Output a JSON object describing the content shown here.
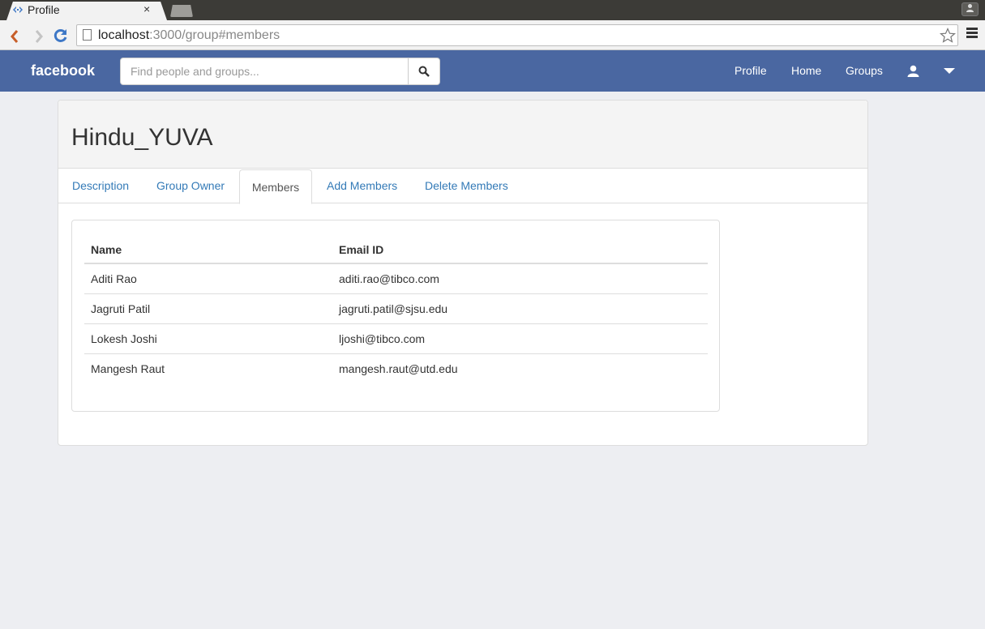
{
  "browser": {
    "tab_title": "Profile",
    "tab_close": "×",
    "url_host": "localhost",
    "url_path": ":3000/group#members"
  },
  "header": {
    "brand": "facebook",
    "search_placeholder": "Find people and groups...",
    "nav": [
      "Profile",
      "Home",
      "Groups"
    ]
  },
  "group": {
    "title": "Hindu_YUVA",
    "tabs": [
      "Description",
      "Group Owner",
      "Members",
      "Add Members",
      "Delete Members"
    ],
    "active_tab": "Members"
  },
  "members_table": {
    "columns": [
      "Name",
      "Email ID"
    ],
    "rows": [
      {
        "name": "Aditi Rao",
        "email": "aditi.rao@tibco.com"
      },
      {
        "name": "Jagruti Patil",
        "email": "jagruti.patil@sjsu.edu"
      },
      {
        "name": "Lokesh Joshi",
        "email": "ljoshi@tibco.com"
      },
      {
        "name": "Mangesh Raut",
        "email": "mangesh.raut@utd.edu"
      }
    ]
  },
  "colors": {
    "header_bg": "#4a67a1",
    "link": "#337ab7",
    "page_bg": "#edeef2"
  }
}
